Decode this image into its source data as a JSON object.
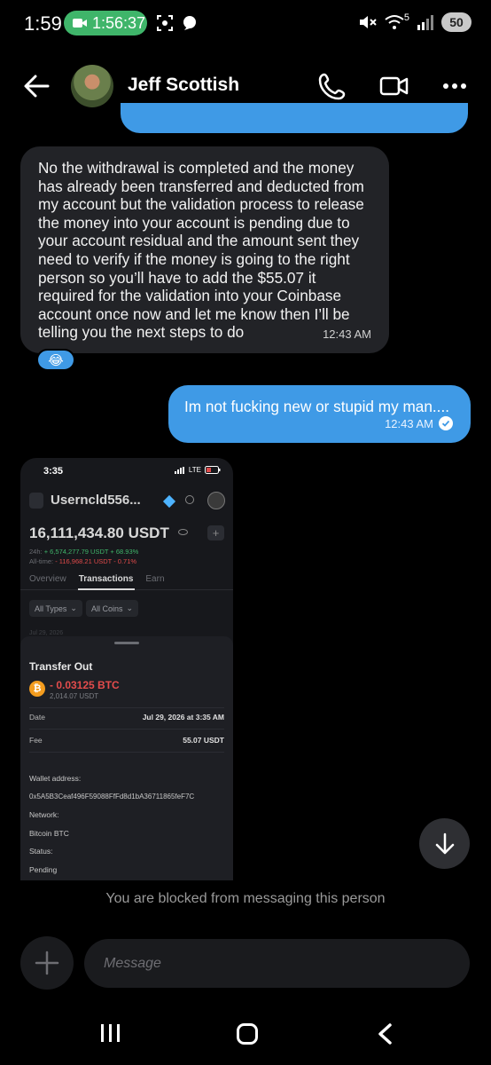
{
  "status_bar": {
    "time": "1:59",
    "call_timer": "1:56:37",
    "signal_label": "5",
    "battery": "50"
  },
  "header": {
    "contact_name": "Jeff Scottish"
  },
  "messages": {
    "incoming": {
      "text": "No the withdrawal is completed and the money has already been transferred and deducted from my account but the validation process to release the money into your account is pending due to your account residual and the amount sent they need to verify if the money is going to the right person so you’ll have to add the $55.07 it required for the validation into your Coinbase account once now and let me know then I’ll be telling you the next steps to do",
      "time": "12:43 AM",
      "reaction": "😂"
    },
    "outgoing": {
      "text": "Im not fucking new or stupid my man....",
      "time": "12:43 AM"
    }
  },
  "screenshot": {
    "time": "3:35",
    "network": "LTE",
    "username": "Usernc​ld556...",
    "balance": "16,111,434.80 USDT",
    "day_change_label": "24h:",
    "day_change": "+ 6,574,277.79 USDT + 68.93%",
    "all_time_label": "All-time:",
    "all_time": "- 116,968.21 USDT - 0.71%",
    "tabs": [
      "Overview",
      "Transactions",
      "Earn"
    ],
    "filters": [
      "All Types",
      "All Coins"
    ],
    "faint_date": "Jul 29, 2026",
    "sheet": {
      "title": "Transfer Out",
      "btc_symbol": "₿",
      "amount": "- 0.03125 BTC",
      "amount_usdt": "2,014.07 USDT",
      "date_label": "Date",
      "date_value": "Jul 29, 2026 at 3:35 AM",
      "fee_label": "Fee",
      "fee_value": "55.07 USDT",
      "wallet_label": "Wallet address:",
      "wallet_value": "0x5A5B3Ceaf496F59088FfFd8d1bA36711865feF7C",
      "network_label": "Network:",
      "network_value": "Bitcoin BTC",
      "status_label": "Status:",
      "status_value": "Pending"
    }
  },
  "blocked_notice": "You are blocked from messaging this person",
  "composer": {
    "placeholder": "Message"
  },
  "icons": [
    "back-arrow-icon",
    "phone-icon",
    "video-camera-icon",
    "more-icon",
    "arrow-down-icon",
    "plus-icon",
    "recent-apps-icon",
    "home-icon",
    "nav-back-icon"
  ],
  "colors": {
    "outgoing_bubble": "#3f9ae6",
    "incoming_bubble": "#222327",
    "call_pill": "#3fb56a"
  }
}
